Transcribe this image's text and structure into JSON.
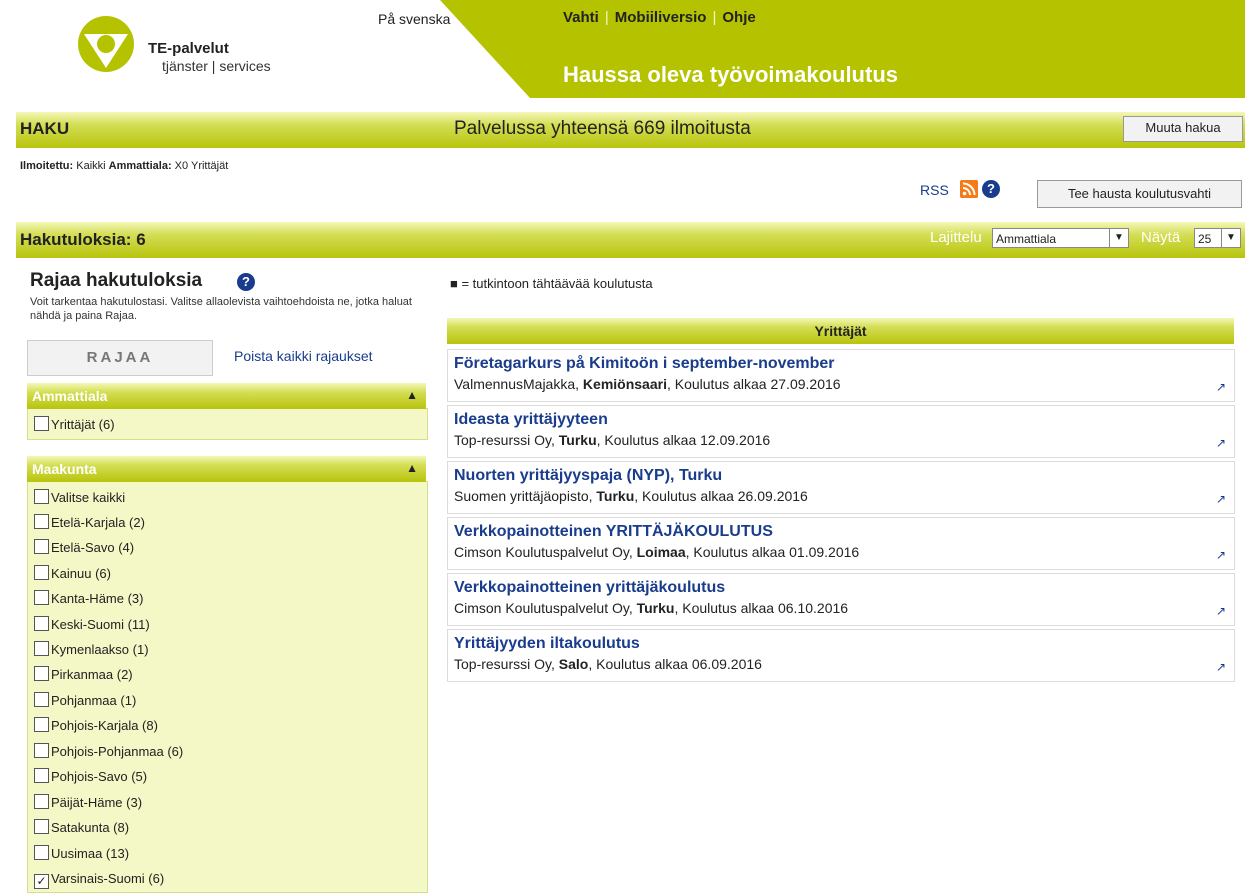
{
  "header": {
    "language_link": "På svenska",
    "top_links": [
      "Vahti",
      "Mobiiliversio",
      "Ohje"
    ],
    "separator": "|",
    "tagline": "Haussa oleva työvoimakoulutus",
    "brand_name": "TE-palvelut",
    "brand_sub": "tjänster | services"
  },
  "search_bar": {
    "title": "HAKU",
    "count_text": "Palvelussa yhteensä 669 ilmoitusta",
    "modify_button": "Muuta hakua"
  },
  "criteria": {
    "label1": "Ilmoitettu:",
    "value1": "Kaikki",
    "label2": "Ammattiala:",
    "value2": "X0 Yrittäjät"
  },
  "rss": {
    "label": "RSS",
    "alert_button": "Tee hausta koulutusvahti"
  },
  "results_bar": {
    "title": "Hakutuloksia: 6",
    "sort_label": "Lajittelu",
    "sort_value": "Ammattiala",
    "show_label": "Näytä",
    "show_value": "25"
  },
  "filters": {
    "title": "Rajaa hakutuloksia",
    "description": "Voit tarkentaa hakutulostasi. Valitse allaolevista vaihtoehdoista ne, jotka haluat nähdä ja paina Rajaa.",
    "apply_button": "RAJAA",
    "clear_link": "Poista kaikki rajaukset",
    "groups": [
      {
        "title": "Ammattiala",
        "items": [
          {
            "label": "Yrittäjät (6)",
            "checked": false
          }
        ]
      },
      {
        "title": "Maakunta",
        "items": [
          {
            "label": "Valitse kaikki",
            "checked": false
          },
          {
            "label": "Etelä-Karjala (2)",
            "checked": false
          },
          {
            "label": "Etelä-Savo (4)",
            "checked": false
          },
          {
            "label": "Kainuu (6)",
            "checked": false
          },
          {
            "label": "Kanta-Häme (3)",
            "checked": false
          },
          {
            "label": "Keski-Suomi (11)",
            "checked": false
          },
          {
            "label": "Kymenlaakso (1)",
            "checked": false
          },
          {
            "label": "Pirkanmaa (2)",
            "checked": false
          },
          {
            "label": "Pohjanmaa (1)",
            "checked": false
          },
          {
            "label": "Pohjois-Karjala (8)",
            "checked": false
          },
          {
            "label": "Pohjois-Pohjanmaa (6)",
            "checked": false
          },
          {
            "label": "Pohjois-Savo (5)",
            "checked": false
          },
          {
            "label": "Päijät-Häme (3)",
            "checked": false
          },
          {
            "label": "Satakunta (8)",
            "checked": false
          },
          {
            "label": "Uusimaa (13)",
            "checked": false
          },
          {
            "label": "Varsinais-Suomi (6)",
            "checked": true
          }
        ]
      }
    ]
  },
  "legend": "■ = tutkintoon tähtäävää koulutusta",
  "category": "Yrittäjät",
  "results": [
    {
      "title": "Företagarkurs på Kimitoön i september-november",
      "provider": "ValmennusMajakka, ",
      "place": "Kemiönsaari",
      "start": ", Koulutus alkaa 27.09.2016"
    },
    {
      "title": "Ideasta yrittäjyyteen",
      "provider": "Top-resurssi Oy, ",
      "place": "Turku",
      "start": ", Koulutus alkaa 12.09.2016"
    },
    {
      "title": "Nuorten yrittäjyyspaja (NYP), Turku",
      "provider": "Suomen yrittäjäopisto, ",
      "place": "Turku",
      "start": ", Koulutus alkaa 26.09.2016"
    },
    {
      "title": "Verkkopainotteinen YRITTÄJÄKOULUTUS",
      "provider": "Cimson Koulutuspalvelut Oy, ",
      "place": "Loimaa",
      "start": ", Koulutus alkaa 01.09.2016"
    },
    {
      "title": "Verkkopainotteinen yrittäjäkoulutus",
      "provider": "Cimson Koulutuspalvelut Oy, ",
      "place": "Turku",
      "start": ", Koulutus alkaa 06.10.2016"
    },
    {
      "title": "Yrittäjyyden iltakoulutus",
      "provider": "Top-resurssi Oy, ",
      "place": "Salo",
      "start": ", Koulutus alkaa 06.09.2016"
    }
  ],
  "icons": {
    "collapse": "▲",
    "external_link": "↗",
    "select_arrow": "▼",
    "help": "?",
    "check": "✓"
  },
  "colors": {
    "brand_green": "#b5c200",
    "link_blue": "#1a3c8c",
    "rss_orange": "#f57b16"
  }
}
